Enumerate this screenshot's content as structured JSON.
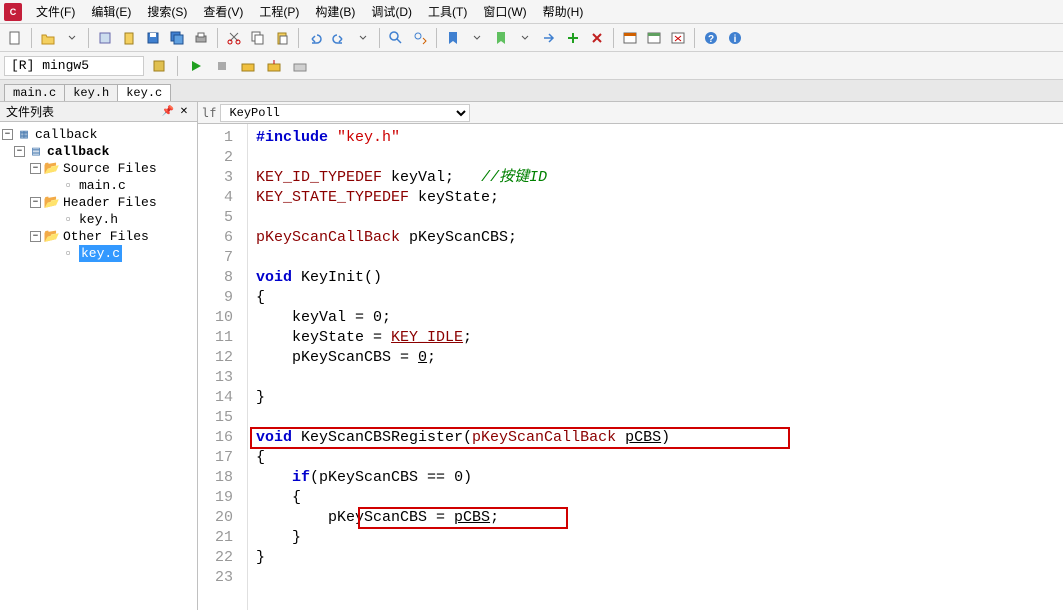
{
  "app": {
    "icon_text": "C"
  },
  "menu": {
    "file": "文件(F)",
    "edit": "编辑(E)",
    "search": "搜索(S)",
    "view": "查看(V)",
    "project": "工程(P)",
    "build": "构建(B)",
    "debug": "调试(D)",
    "tools": "工具(T)",
    "window": "窗口(W)",
    "help": "帮助(H)"
  },
  "target": "[R] mingw5",
  "tabs": [
    "main.c",
    "key.h",
    "key.c"
  ],
  "active_tab": 2,
  "sidebar": {
    "title": "文件列表",
    "tree": {
      "root": "callback",
      "project": "callback",
      "folders": [
        {
          "name": "Source Files",
          "files": [
            "main.c"
          ]
        },
        {
          "name": "Header Files",
          "files": [
            "key.h"
          ]
        },
        {
          "name": "Other Files",
          "files": [
            "key.c"
          ],
          "selected": 0
        }
      ]
    }
  },
  "editor": {
    "func_label": "lf",
    "func_dropdown": "KeyPoll",
    "lines": [
      {
        "n": 1,
        "segs": [
          {
            "t": "#include ",
            "c": "kw"
          },
          {
            "t": "\"key.h\"",
            "c": "str"
          }
        ]
      },
      {
        "n": 2,
        "segs": []
      },
      {
        "n": 3,
        "segs": [
          {
            "t": "KEY_ID_TYPEDEF",
            "c": "type"
          },
          {
            "t": " keyVal;   ",
            "c": "ident"
          },
          {
            "t": "//按键ID",
            "c": "comment"
          }
        ]
      },
      {
        "n": 4,
        "segs": [
          {
            "t": "KEY_STATE_TYPEDEF",
            "c": "type"
          },
          {
            "t": " keyState;",
            "c": "ident"
          }
        ]
      },
      {
        "n": 5,
        "segs": []
      },
      {
        "n": 6,
        "segs": [
          {
            "t": "pKeyScanCallBack",
            "c": "type"
          },
          {
            "t": " pKeyScanCBS;",
            "c": "ident"
          }
        ]
      },
      {
        "n": 7,
        "segs": []
      },
      {
        "n": 8,
        "segs": [
          {
            "t": "void",
            "c": "kw"
          },
          {
            "t": " KeyInit()",
            "c": "ident"
          }
        ]
      },
      {
        "n": 9,
        "segs": [
          {
            "t": "{",
            "c": "ident"
          }
        ]
      },
      {
        "n": 10,
        "segs": [
          {
            "t": "    keyVal = ",
            "c": "ident"
          },
          {
            "t": "0",
            "c": "num"
          },
          {
            "t": ";",
            "c": "ident"
          }
        ]
      },
      {
        "n": 11,
        "segs": [
          {
            "t": "    keyState = ",
            "c": "ident"
          },
          {
            "t": "KEY_IDLE",
            "c": "type underline"
          },
          {
            "t": ";",
            "c": "ident"
          }
        ]
      },
      {
        "n": 12,
        "segs": [
          {
            "t": "    pKeyScanCBS = ",
            "c": "ident"
          },
          {
            "t": "0",
            "c": "num underline"
          },
          {
            "t": ";",
            "c": "ident"
          }
        ]
      },
      {
        "n": 13,
        "segs": []
      },
      {
        "n": 14,
        "segs": [
          {
            "t": "}",
            "c": "ident"
          }
        ]
      },
      {
        "n": 15,
        "segs": []
      },
      {
        "n": 16,
        "segs": [
          {
            "t": "void",
            "c": "kw"
          },
          {
            "t": " KeyScanCBSRegister(",
            "c": "ident"
          },
          {
            "t": "pKeyScanCallBack",
            "c": "type"
          },
          {
            "t": " ",
            "c": "ident"
          },
          {
            "t": "pCBS",
            "c": "ident underline"
          },
          {
            "t": ")",
            "c": "ident"
          }
        ]
      },
      {
        "n": 17,
        "segs": [
          {
            "t": "{",
            "c": "ident"
          }
        ]
      },
      {
        "n": 18,
        "segs": [
          {
            "t": "    ",
            "c": "ident"
          },
          {
            "t": "if",
            "c": "kw"
          },
          {
            "t": "(pKeyScanCBS == ",
            "c": "ident"
          },
          {
            "t": "0",
            "c": "num"
          },
          {
            "t": ")",
            "c": "ident"
          }
        ]
      },
      {
        "n": 19,
        "segs": [
          {
            "t": "    {",
            "c": "ident"
          }
        ]
      },
      {
        "n": 20,
        "segs": [
          {
            "t": "        pKeyScanCBS = ",
            "c": "ident"
          },
          {
            "t": "pCBS",
            "c": "ident underline"
          },
          {
            "t": ";",
            "c": "ident"
          }
        ]
      },
      {
        "n": 21,
        "segs": [
          {
            "t": "    }",
            "c": "ident"
          }
        ]
      },
      {
        "n": 22,
        "segs": [
          {
            "t": "}",
            "c": "ident"
          }
        ]
      },
      {
        "n": 23,
        "segs": []
      }
    ]
  }
}
